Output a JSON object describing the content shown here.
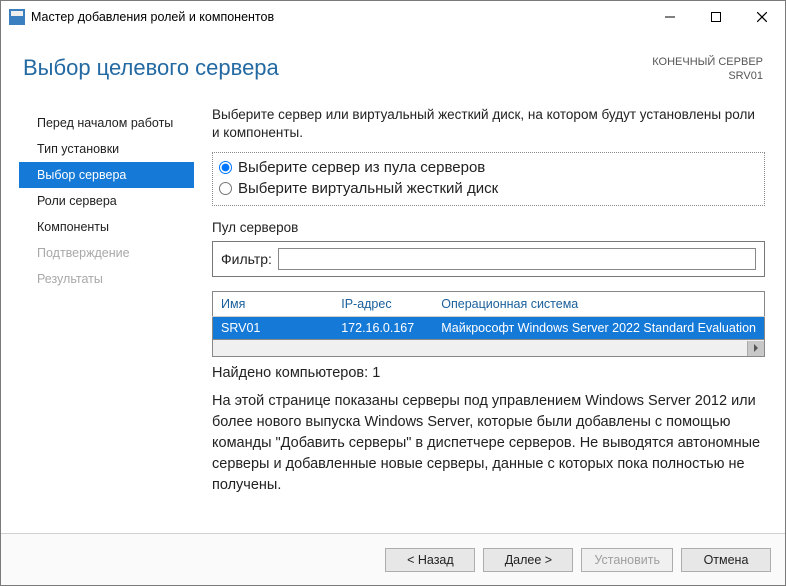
{
  "window": {
    "title": "Мастер добавления ролей и компонентов"
  },
  "header": {
    "title": "Выбор целевого сервера",
    "dest_label": "КОНЕЧНЫЙ СЕРВЕР",
    "dest_value": "SRV01"
  },
  "sidebar": {
    "items": [
      {
        "label": "Перед началом работы",
        "state": "normal"
      },
      {
        "label": "Тип установки",
        "state": "normal"
      },
      {
        "label": "Выбор сервера",
        "state": "active"
      },
      {
        "label": "Роли сервера",
        "state": "normal"
      },
      {
        "label": "Компоненты",
        "state": "normal"
      },
      {
        "label": "Подтверждение",
        "state": "disabled"
      },
      {
        "label": "Результаты",
        "state": "disabled"
      }
    ]
  },
  "main": {
    "instructions": "Выберите сервер или виртуальный жесткий диск, на котором будут установлены роли и компоненты.",
    "radio": {
      "opt1": "Выберите сервер из пула серверов",
      "opt2": "Выберите виртуальный жесткий диск",
      "selected": 0
    },
    "pool_label": "Пул серверов",
    "filter_label": "Фильтр:",
    "filter_value": "",
    "table": {
      "columns": [
        "Имя",
        "IP-адрес",
        "Операционная система"
      ],
      "rows": [
        {
          "name": "SRV01",
          "ip": "172.16.0.167",
          "os": "Майкрософт Windows Server 2022 Standard Evaluation",
          "selected": true
        }
      ]
    },
    "found": "Найдено компьютеров: 1",
    "description": "На этой странице показаны серверы под управлением Windows Server 2012 или более нового выпуска Windows Server, которые были добавлены с помощью команды \"Добавить серверы\" в диспетчере серверов. Не выводятся автономные серверы и добавленные новые серверы, данные с которых пока полностью не получены."
  },
  "footer": {
    "back": "< Назад",
    "next": "Далее >",
    "install": "Установить",
    "cancel": "Отмена"
  }
}
